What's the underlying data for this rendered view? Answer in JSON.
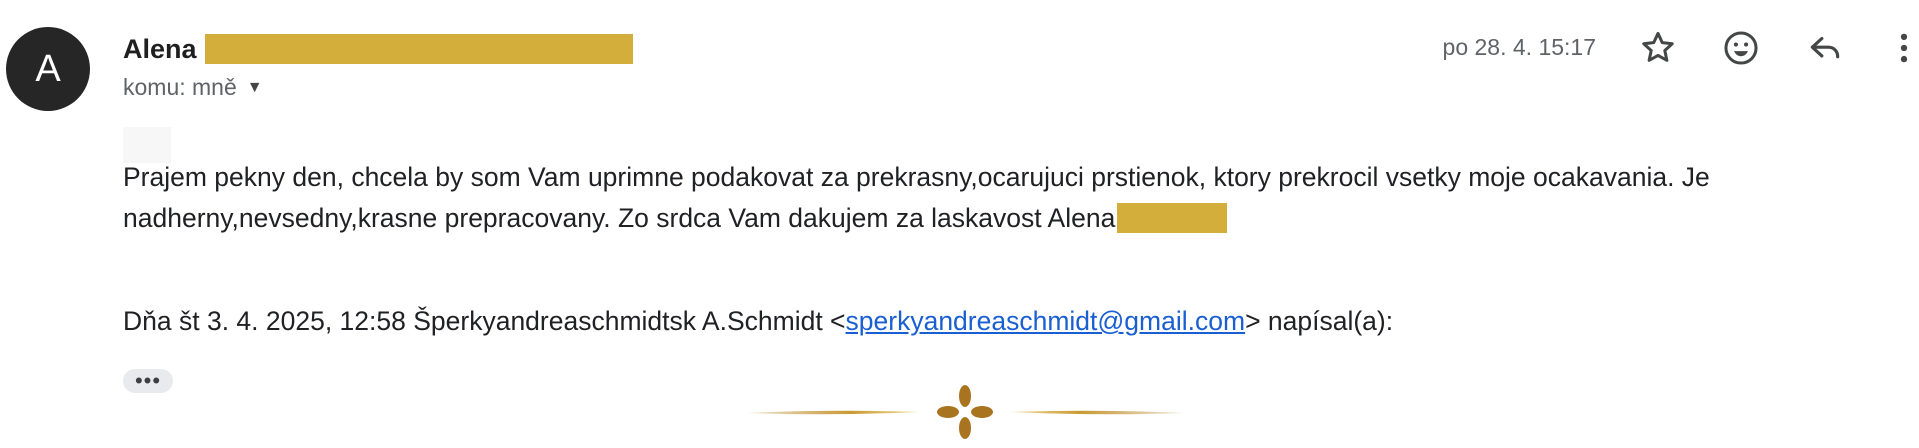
{
  "sender": {
    "avatar_letter": "A",
    "name": "Alena"
  },
  "recipient": {
    "label": "komu: mně"
  },
  "date": "po 28. 4. 15:17",
  "actions": {
    "star": "star-icon",
    "emoji": "emoji-icon",
    "reply": "reply-icon",
    "more": "more-vert-icon"
  },
  "message": {
    "body_line1": "Prajem pekny den, chcela by som Vam uprimne podakovat za prekrasny,ocarujuci prstienok, ktory prekrocil vsetky moje ocakavania. Je",
    "body_line2": "nadherny,nevsedny,krasne prepracovany. Zo srdca Vam dakujem za laskavost  Alena"
  },
  "quote": {
    "prefix": "Dňa št 3. 4. 2025, 12:58 Šperkyandreaschmidtsk A.Schmidt <",
    "email": "sperkyandreaschmidt@gmail.com",
    "suffix": "> napísal(a):"
  },
  "show_trimmed": "•••",
  "colors": {
    "avatar": "#262626",
    "redaction": "#d4ae3a",
    "link": "#1a5fd1",
    "ornament": "#b8862b"
  }
}
